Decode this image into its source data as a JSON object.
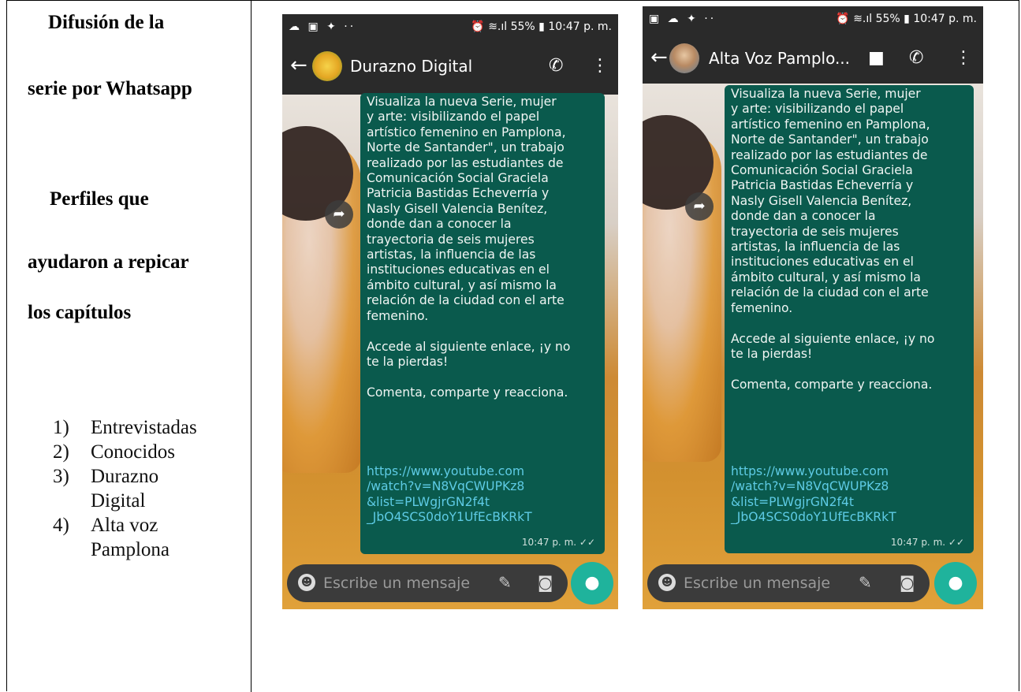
{
  "left_column": {
    "heading_line1": "Difusión de la",
    "heading_line2": "serie por Whatsapp",
    "subheading_line1": "Perfiles que",
    "subheading_line2": "ayudaron a repicar",
    "subheading_line3": "los capítulos",
    "list": [
      {
        "num": "1)",
        "lines": [
          "Entrevistadas"
        ]
      },
      {
        "num": "2)",
        "lines": [
          "Conocidos"
        ]
      },
      {
        "num": "3)",
        "lines": [
          "Durazno",
          "Digital"
        ]
      },
      {
        "num": "4)",
        "lines": [
          "Alta voz",
          "Pamplona"
        ]
      }
    ]
  },
  "phones": [
    {
      "status_left": "☁ ▣ ✦ ··",
      "status_right": "⏰ ≋.ıl 55% ▮ 10:47 p. m.",
      "chat_title": "Durazno Digital",
      "message": "Visualiza la nueva Serie, mujer\ny arte: visibilizando el papel\nartístico femenino en Pamplona,\nNorte de Santander\", un trabajo\nrealizado por las estudiantes de\nComunicación Social Graciela\nPatricia Bastidas Echeverría y\nNasly Gisell Valencia Benítez,\ndonde dan a conocer la\ntrayectoria de seis mujeres\nartistas, la influencia de las\ninstituciones educativas en el\námbito cultural, y así mismo la\nrelación de la ciudad con el arte\nfemenino.\n\nAccede al siguiente enlace, ¡y no\nte la pierdas!\n\nComenta, comparte y reacciona.",
      "link": "https://www.youtube.com\n/watch?v=N8VqCWUPKz8\n&list=PLWgjrGN2f4t\n_JbO4SCS0doY1UfEcBKRkT",
      "time": "10:47 p. m. ✓✓",
      "placeholder": "Escribe un mensaje"
    },
    {
      "status_left": "▣ ☁ ✦ ··",
      "status_right": "⏰ ≋.ıl 55% ▮ 10:47 p. m.",
      "chat_title": "Alta Voz Pamplo...",
      "message": "Visualiza la nueva Serie, mujer\ny arte: visibilizando el papel\nartístico femenino en Pamplona,\nNorte de Santander\", un trabajo\nrealizado por las estudiantes de\nComunicación Social Graciela\nPatricia Bastidas Echeverría y\nNasly Gisell Valencia Benítez,\ndonde dan a conocer la\ntrayectoria de seis mujeres\nartistas, la influencia de las\ninstituciones educativas en el\námbito cultural, y así mismo la\nrelación de la ciudad con el arte\nfemenino.\n\nAccede al siguiente enlace, ¡y no\nte la pierdas!\n\nComenta, comparte y reacciona.",
      "link": "https://www.youtube.com\n/watch?v=N8VqCWUPKz8\n&list=PLWgjrGN2f4t\n_JbO4SCS0doY1UfEcBKRkT",
      "time": "10:47 p. m. ✓✓",
      "placeholder": "Escribe un mensaje"
    }
  ],
  "icons": {
    "back": "arrow-left-icon",
    "add_call": "add-call-icon",
    "video": "video-camera-icon",
    "phone": "phone-icon",
    "menu": "more-vert-icon",
    "forward": "forward-icon",
    "emoji": "emoji-icon",
    "attach": "paperclip-icon",
    "camera": "camera-icon",
    "mic": "microphone-icon"
  },
  "colors": {
    "bubble": "#0a5a4d",
    "link": "#5ecbe5",
    "appbar": "#2a2a2a",
    "mic_button": "#1fb39c"
  }
}
